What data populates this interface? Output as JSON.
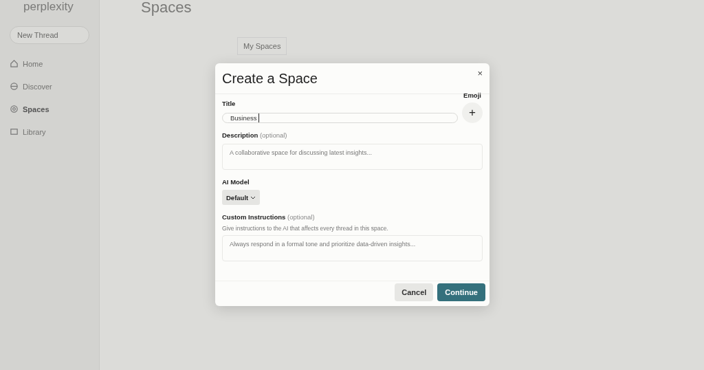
{
  "sidebar": {
    "logo": "perplexity",
    "new_thread": "New Thread",
    "items": [
      {
        "label": "Home",
        "selected": false
      },
      {
        "label": "Discover",
        "selected": false
      },
      {
        "label": "Spaces",
        "selected": true
      },
      {
        "label": "Library",
        "selected": false
      }
    ]
  },
  "main": {
    "title": "Spaces",
    "tab": "My Spaces"
  },
  "dialog": {
    "title": "Create a Space",
    "close": "×",
    "title_field": {
      "label": "Title",
      "value": "Business",
      "focused": true
    },
    "emoji": {
      "label": "Emoji",
      "button": "+"
    },
    "description": {
      "label": "Description",
      "hint": "(optional)",
      "placeholder": "A collaborative space for discussing latest insights..."
    },
    "model": {
      "label": "AI Model",
      "value": "Default"
    },
    "instructions": {
      "label": "Custom Instructions",
      "hint": "(optional)",
      "help": "Give instructions to the AI that affects every thread in this space.",
      "placeholder": "Always respond in a formal tone and prioritize data-driven insights..."
    },
    "buttons": [
      {
        "label": "Cancel",
        "kind": "secondary"
      },
      {
        "label": "Continue",
        "kind": "primary"
      }
    ]
  }
}
